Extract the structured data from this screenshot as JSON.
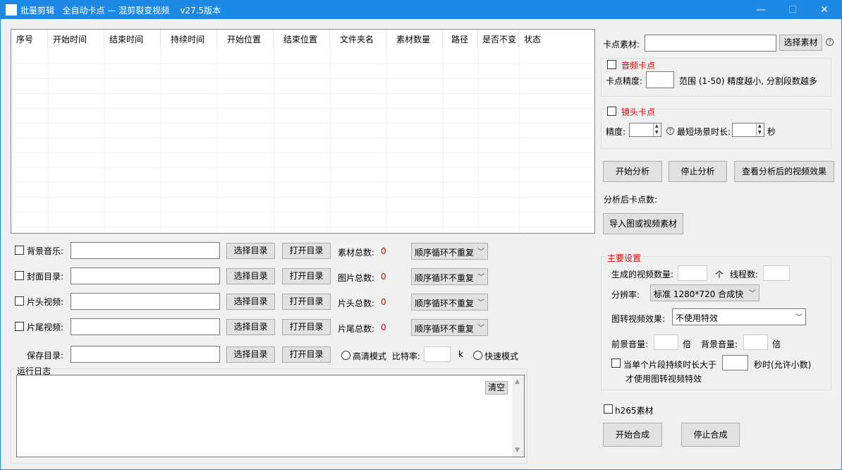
{
  "window": {
    "title": "批量剪辑   全自动卡点 — 混剪裂变视频    v27.5版本",
    "minimize": "—",
    "maximize": "☐",
    "close": "✕"
  },
  "table": {
    "columns": [
      "序号",
      "开始时间",
      "结束时间",
      "持续时间",
      "开始位置",
      "结束位置",
      "文件夹名",
      "素材数量",
      "路径",
      "是否不变",
      "状态"
    ],
    "rows": []
  },
  "left_rows": [
    {
      "checkbox_label": "背景音乐:",
      "select_dir": "选择目录",
      "open_dir": "打开目录",
      "count_label": "素材总数:",
      "count_value": "0",
      "order": "顺序循环不重复"
    },
    {
      "checkbox_label": "封面目录:",
      "select_dir": "选择目录",
      "open_dir": "打开目录",
      "count_label": "图片总数:",
      "count_value": "0",
      "order": "顺序循环不重复"
    },
    {
      "checkbox_label": "片头视频:",
      "select_dir": "选择目录",
      "open_dir": "打开目录",
      "count_label": "片头总数:",
      "count_value": "0",
      "order": "顺序循环不重复"
    },
    {
      "checkbox_label": "片尾视频:",
      "select_dir": "选择目录",
      "open_dir": "打开目录",
      "count_label": "片尾总数:",
      "count_value": "0",
      "order": "顺序循环不重复"
    }
  ],
  "save": {
    "label": "保存目录:",
    "select_dir": "选择目录",
    "open_dir": "打开目录",
    "hd_mode": "高清模式",
    "bitrate_label": "比特率:",
    "bitrate_unit": "k",
    "fast_mode": "快速模式"
  },
  "log": {
    "group_label": "运行日志",
    "clear": "清空"
  },
  "right": {
    "material_label": "卡点素材:",
    "select_material": "选择素材",
    "help": "?",
    "audio": {
      "title": "音频卡点",
      "precision_label": "卡点精度:",
      "range_text": "范围 (1-50) 精度越小, 分割段数越多"
    },
    "shot": {
      "title": "镜头卡点",
      "precision_label": "精度:",
      "min_scene_label": "最短场景时长:",
      "seconds": "秒"
    },
    "start_analysis": "开始分析",
    "stop_analysis": "停止分析",
    "view_effect": "查看分析后的视频效果",
    "points_label": "分析后卡点数:",
    "import_btn": "导入图或视频素材",
    "main": {
      "title": "主要设置",
      "count_label": "生成的视频数量:",
      "count_unit": "个",
      "threads_label": "线程数:",
      "resolution_label": "分辨率:",
      "resolution_value": "标准 1280*720 合成快",
      "effect_label": "图转视频效果:",
      "effect_value": "不使用特效",
      "fg_volume_label": "前景音量:",
      "times": "倍",
      "bg_volume_label": "背景音量:",
      "duration_text": "当单个片段持续时长大于",
      "duration_suffix": "秒时(允许小数)",
      "duration_line2": "才使用图转视频特效"
    },
    "h265": "h265素材",
    "start_compose": "开始合成",
    "stop_compose": "停止合成"
  }
}
